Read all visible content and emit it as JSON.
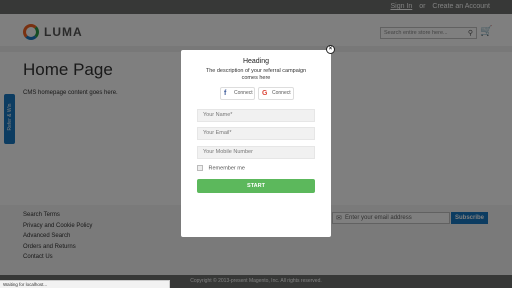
{
  "header": {
    "top_links": {
      "sign_in": "Sign In",
      "or": "or",
      "create_account": "Create an Account"
    },
    "logo_text": "LUMA",
    "search_placeholder": "Search entire store here...",
    "cart_icon": "cart-icon",
    "search_icon": "search-icon"
  },
  "main": {
    "page_title": "Home Page",
    "cms_text": "CMS homepage content goes here."
  },
  "side_tab": {
    "label": "Refer & Win"
  },
  "footer": {
    "links": [
      "Search Terms",
      "Privacy and Cookie Policy",
      "Advanced Search",
      "Orders and Returns",
      "Contact Us"
    ],
    "newsletter_placeholder": "Enter your email address",
    "subscribe_label": "Subscribe",
    "copyright": "Copyright © 2013-present Magento, Inc. All rights reserved."
  },
  "status_bar": {
    "text": "Waiting for localhost..."
  },
  "modal": {
    "heading": "Heading",
    "description": "The description of your referral campaign comes here",
    "social": {
      "facebook_label": "Connect",
      "google_label": "Connect"
    },
    "fields": {
      "name_placeholder": "Your Name*",
      "email_placeholder": "Your Email*",
      "mobile_placeholder": "Your Mobile Number"
    },
    "remember_label": "Remember me",
    "start_label": "START",
    "close_symbol": "×"
  },
  "colors": {
    "brand_orange": "#f26322",
    "primary_blue": "#1979c3",
    "start_green": "#5cb85c",
    "facebook_blue": "#3b5998",
    "google_red": "#db4437",
    "top_bar_gray": "#6e716e"
  }
}
